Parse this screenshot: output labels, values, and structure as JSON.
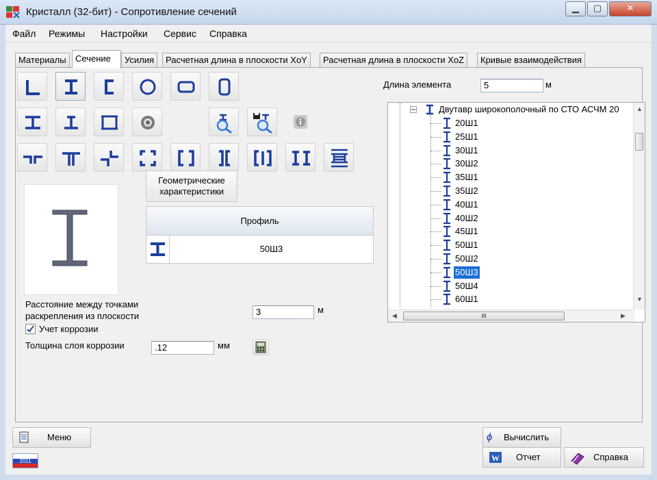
{
  "window": {
    "title": "Кристалл (32-бит) - Сопротивление сечений",
    "min_label": "▁",
    "max_label": "▢",
    "close_label": "✕"
  },
  "menu": [
    "Файл",
    "Режимы",
    "Настройки",
    "Сервис",
    "Справка"
  ],
  "tabs": [
    "Материалы",
    "Сечение",
    "Усилия",
    "Расчетная длина в плоскости XoY",
    "Расчетная длина в плоскости XoZ",
    "Кривые взаимодействия"
  ],
  "active_tab": "Сечение",
  "section_panel": {
    "geom_button_line1": "Геометрические",
    "geom_button_line2": "характеристики",
    "profile_header": "Профиль",
    "profile_value": "50Ш3",
    "distance_label_line1": "Расстояние между точками",
    "distance_label_line2": "раскрепления из плоскости",
    "distance_value": "3",
    "distance_unit": "м",
    "corrosion_checkbox_label": "Учет коррозии",
    "corrosion_checked": true,
    "corrosion_thickness_label": "Толщина слоя коррозии",
    "corrosion_thickness_value": ".12",
    "corrosion_thickness_unit": "мм",
    "element_length_label": "Длина элемента",
    "element_length_value": "5",
    "element_length_unit": "м"
  },
  "tree": {
    "group_label": "Двутавр широкополочный по СТО АСЧМ 20",
    "items": [
      "20Ш1",
      "25Ш1",
      "30Ш1",
      "30Ш2",
      "35Ш1",
      "35Ш2",
      "40Ш1",
      "40Ш2",
      "45Ш1",
      "50Ш1",
      "50Ш2",
      "50Ш3",
      "50Ш4",
      "60Ш1"
    ],
    "selected": "50Ш3",
    "hscroll_grip": "III"
  },
  "bottom": {
    "menu_button": "Меню",
    "calc_button": "Вычислить",
    "report_button": "Отчет",
    "help_button": "Справка",
    "flag_text": "2011"
  },
  "colors": {
    "accent_blue": "#1c3d9c",
    "selection": "#1c6fd4"
  }
}
